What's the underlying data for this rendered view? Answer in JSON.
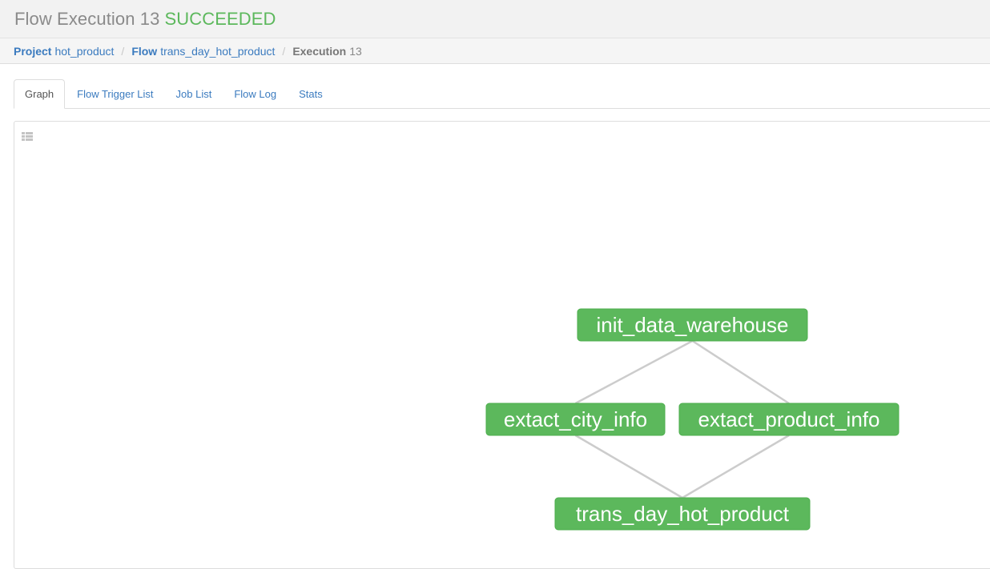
{
  "header": {
    "title": "Flow Execution 13",
    "status": "SUCCEEDED"
  },
  "breadcrumb": {
    "project": {
      "key": "Project",
      "value": "hot_product"
    },
    "flow": {
      "key": "Flow",
      "value": "trans_day_hot_product"
    },
    "execution": {
      "key": "Execution",
      "value": "13"
    }
  },
  "tabs": [
    {
      "label": "Graph",
      "active": true
    },
    {
      "label": "Flow Trigger List",
      "active": false
    },
    {
      "label": "Job List",
      "active": false
    },
    {
      "label": "Flow Log",
      "active": false
    },
    {
      "label": "Stats",
      "active": false
    }
  ],
  "graph": {
    "toggle_icon": "list-icon",
    "nodes": [
      {
        "id": "init_data_warehouse",
        "label": "init_data_warehouse",
        "status": "SUCCEEDED"
      },
      {
        "id": "extact_city_info",
        "label": "extact_city_info",
        "status": "SUCCEEDED"
      },
      {
        "id": "extact_product_info",
        "label": "extact_product_info",
        "status": "SUCCEEDED"
      },
      {
        "id": "trans_day_hot_product",
        "label": "trans_day_hot_product",
        "status": "SUCCEEDED"
      }
    ],
    "edges": [
      {
        "from": "init_data_warehouse",
        "to": "extact_city_info"
      },
      {
        "from": "init_data_warehouse",
        "to": "extact_product_info"
      },
      {
        "from": "extact_city_info",
        "to": "trans_day_hot_product"
      },
      {
        "from": "extact_product_info",
        "to": "trans_day_hot_product"
      }
    ],
    "colors": {
      "succeeded": "#5cb85c",
      "edge": "#cccccc"
    }
  }
}
